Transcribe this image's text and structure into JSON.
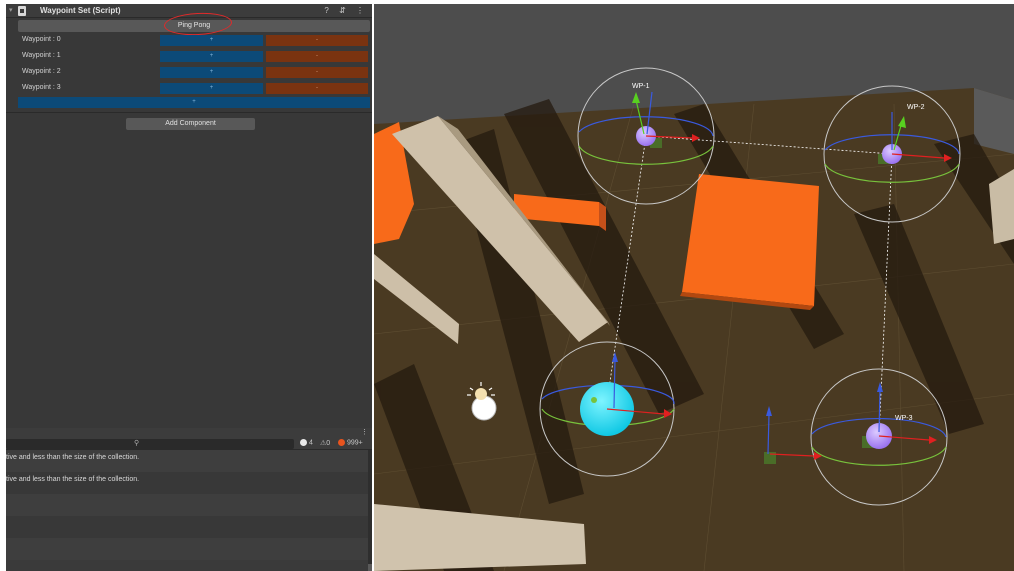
{
  "inspector": {
    "component_title": "Waypoint Set (Script)",
    "header_icons": "? ⇵ ⋮",
    "fold_glyph": "▾",
    "ping_pong_label": "Ping Pong",
    "waypoints": [
      {
        "label": "Waypoint : 0",
        "plus": "+",
        "minus": "-"
      },
      {
        "label": "Waypoint : 1",
        "plus": "+",
        "minus": "-"
      },
      {
        "label": "Waypoint : 2",
        "plus": "+",
        "minus": "-"
      },
      {
        "label": "Waypoint : 3",
        "plus": "+",
        "minus": "-"
      }
    ],
    "add_waypoint_label": "+",
    "add_component_label": "Add Component"
  },
  "console": {
    "more_glyph": "⋮",
    "search_glyph": "🔍",
    "info_count": "4",
    "warning_count": "0",
    "error_count": "999+",
    "messages": [
      "tive and less than the size of the collection.",
      "tive and less than the size of the collection."
    ]
  },
  "scene": {
    "labels": {
      "wp1": "WP-1",
      "wp2": "WP-2",
      "wp3": "WP-3"
    }
  },
  "colors": {
    "plus_button": "#0c4a78",
    "minus_button": "#7a3310",
    "highlight_circle": "#e02a2a",
    "ground": "#4a3a22",
    "orange_block": "#f86a1a",
    "selected_sphere": "#1ad8f0",
    "waypoint_sphere": "#b88cff"
  }
}
